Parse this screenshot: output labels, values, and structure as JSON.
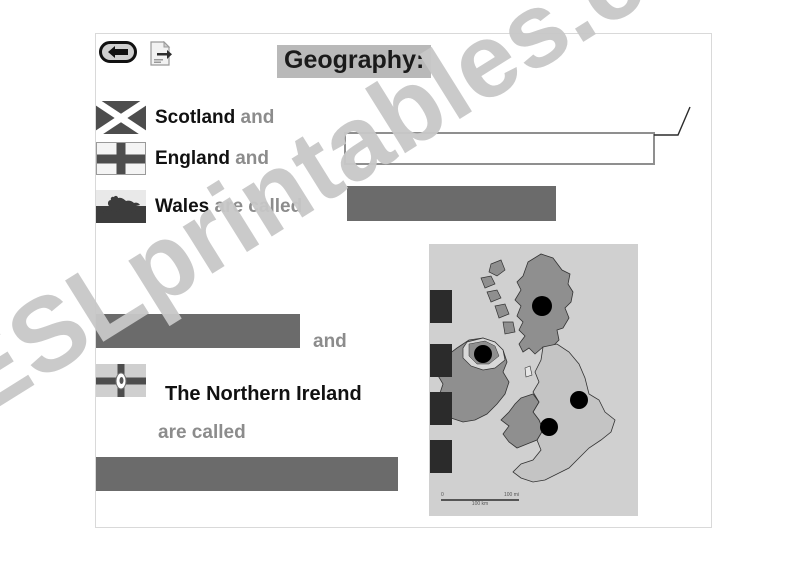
{
  "page": {
    "background_color": "#ffffff",
    "sheet_border_color": "#d9d9d9"
  },
  "watermark": {
    "text": "ESLprintables.com",
    "color": "#c8c8c8"
  },
  "toolbar": {
    "back_button": {
      "icon": "back-arrow-icon",
      "label": ""
    },
    "next_button": {
      "icon": "page-forward-icon",
      "label": ""
    }
  },
  "header": {
    "title": "Geography:",
    "title_highlight_color": "#b9b9b9"
  },
  "exercise": {
    "rows": [
      {
        "flag": "scotland-flag",
        "country": "Scotland",
        "connector": "and"
      },
      {
        "flag": "england-flag",
        "country": "England",
        "connector": "and"
      },
      {
        "flag": "wales-flag",
        "country": "Wales",
        "connector": "are called"
      }
    ],
    "answer_box": {
      "value": "",
      "placeholder": ""
    },
    "redaction_bars": [
      {
        "name": "answer-bar-top",
        "color": "#6b6b6b"
      },
      {
        "name": "answer-bar-middle",
        "color": "#6b6b6b"
      },
      {
        "name": "answer-bar-bottom",
        "color": "#6b6b6b"
      }
    ],
    "middle_connector": "and",
    "northern_ireland": {
      "flag": "northern-ireland-flag",
      "label": "The Northern Ireland",
      "connector": "are called"
    }
  },
  "map": {
    "title": "",
    "background_color": "#d0d0d0",
    "land_light_color": "#c4c4c4",
    "land_dark_color": "#8f8f8f",
    "marker_color": "#000000",
    "markers": [
      {
        "name": "scotland-capital-marker"
      },
      {
        "name": "northern-ireland-capital-marker"
      },
      {
        "name": "england-capital-marker"
      },
      {
        "name": "wales-capital-marker"
      }
    ],
    "scale": {
      "zero": "0",
      "miles": "100 mi",
      "km": "100 km"
    }
  }
}
